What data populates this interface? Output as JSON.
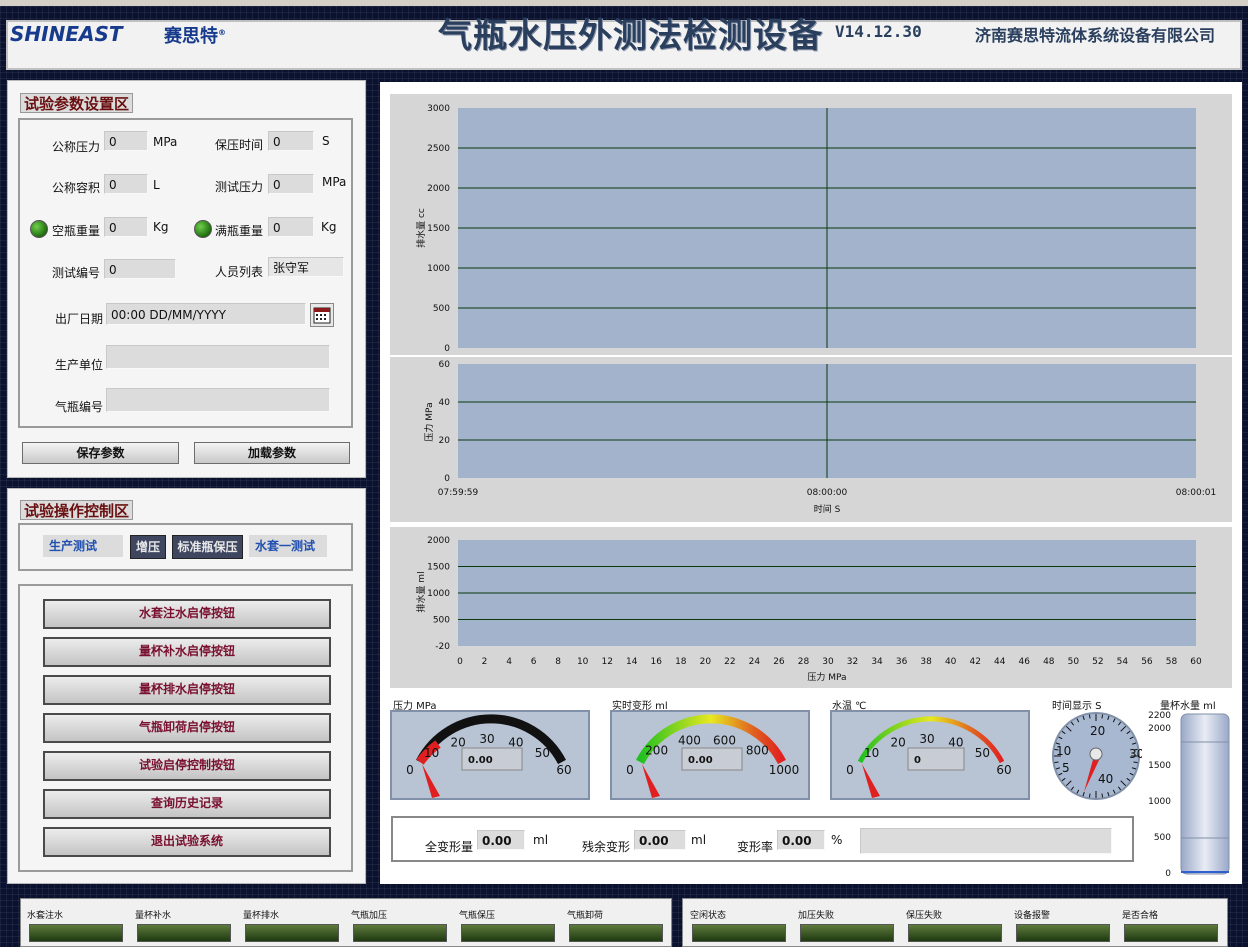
{
  "header": {
    "logo_text": "SHINEAST",
    "logo_cn": "赛思特",
    "logo_mark": "®",
    "title": "气瓶水压外测法检测设备",
    "version": "V14.12.30",
    "company": "济南赛思特流体系统设备有限公司"
  },
  "params": {
    "section_title": "试验参数设置区",
    "nominal_pressure": {
      "label": "公称压力",
      "value": "0",
      "unit": "MPa"
    },
    "hold_time": {
      "label": "保压时间",
      "value": "0",
      "unit": "S"
    },
    "nominal_volume": {
      "label": "公称容积",
      "value": "0",
      "unit": "L"
    },
    "test_pressure": {
      "label": "测试压力",
      "value": "0",
      "unit": "MPa"
    },
    "empty_weight": {
      "label": "空瓶重量",
      "value": "0",
      "unit": "Kg"
    },
    "full_weight": {
      "label": "满瓶重量",
      "value": "0",
      "unit": "Kg"
    },
    "test_no": {
      "label": "测试编号",
      "value": "0"
    },
    "staff": {
      "label": "人员列表",
      "value": "张守军"
    },
    "mfg_date": {
      "label": "出厂日期",
      "value": "00:00 DD/MM/YYYY"
    },
    "maker": {
      "label": "生产单位",
      "value": ""
    },
    "cylinder_no": {
      "label": "气瓶编号",
      "value": ""
    },
    "save_label": "保存参数",
    "load_label": "加载参数"
  },
  "ops": {
    "section_title": "试验操作控制区",
    "mode_production": "生产测试",
    "boost": "增压",
    "std_hold": "标准瓶保压",
    "mode_jacket": "水套一测试",
    "buttons": [
      "水套注水启停按钮",
      "量杯补水启停按钮",
      "量杯排水启停按钮",
      "气瓶卸荷启停按钮",
      "试验启停控制按钮",
      "查询历史记录",
      "退出试验系统"
    ]
  },
  "charts": {
    "chart1": {
      "ylabel": "排水量 cc",
      "yticks": [
        "3000",
        "2500",
        "2000",
        "1500",
        "1000",
        "500",
        "0"
      ]
    },
    "chart2": {
      "ylabel": "压力 MPa",
      "yticks": [
        "60",
        "40",
        "20",
        "0"
      ],
      "xticks": [
        "07:59:59",
        "08:00:00",
        "08:00:01"
      ],
      "xlabel": "时间 S"
    },
    "chart3": {
      "ylabel": "排水量 ml",
      "yticks": [
        "2000",
        "1500",
        "1000",
        "500",
        "-20"
      ],
      "xticks": [
        "0",
        "2",
        "4",
        "6",
        "8",
        "10",
        "12",
        "14",
        "16",
        "18",
        "20",
        "22",
        "24",
        "26",
        "28",
        "30",
        "32",
        "34",
        "36",
        "38",
        "40",
        "42",
        "44",
        "46",
        "48",
        "50",
        "52",
        "54",
        "56",
        "58",
        "60"
      ],
      "xlabel": "压力 MPa"
    }
  },
  "gauges": {
    "pressure": {
      "label": "压力 MPa",
      "ticks": [
        "0",
        "10",
        "20",
        "30",
        "40",
        "50",
        "60"
      ],
      "value": "0.00"
    },
    "deform": {
      "label": "实时变形 ml",
      "ticks": [
        "0",
        "200",
        "400",
        "600",
        "800",
        "1000"
      ],
      "value": "0.00"
    },
    "temp": {
      "label": "水温 ℃",
      "ticks": [
        "0",
        "10",
        "20",
        "30",
        "40",
        "50",
        "60"
      ],
      "value": "0"
    },
    "time": {
      "label": "时间显示 S",
      "ticks": [
        "5",
        "10",
        "20",
        "30",
        "40"
      ]
    },
    "cup": {
      "label": "量杯水量 ml",
      "ticks": [
        "2200",
        "2000",
        "1500",
        "1000",
        "500",
        "0"
      ]
    }
  },
  "results": {
    "total": {
      "label": "全变形量",
      "value": "0.00",
      "unit": "ml"
    },
    "residual": {
      "label": "残余变形",
      "value": "0.00",
      "unit": "ml"
    },
    "rate": {
      "label": "变形率",
      "value": "0.00",
      "unit": "%"
    }
  },
  "status": {
    "left": [
      "水套注水",
      "量杯补水",
      "量杯排水",
      "气瓶加压",
      "气瓶保压",
      "气瓶卸荷"
    ],
    "right": [
      "空闲状态",
      "加压失败",
      "保压失败",
      "设备报警",
      "是否合格"
    ]
  }
}
